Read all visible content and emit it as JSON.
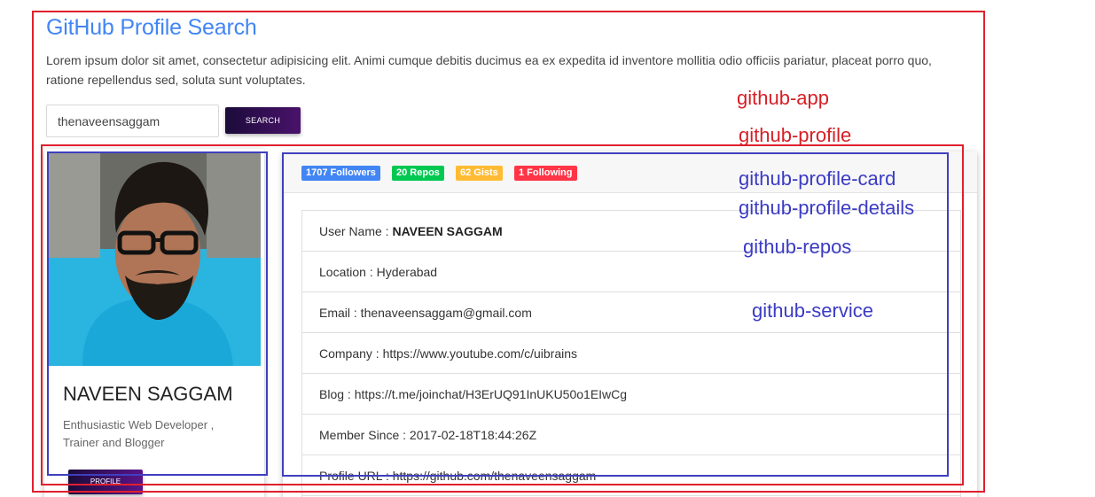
{
  "header": {
    "title": "GitHub Profile Search",
    "description": "Lorem ipsum dolor sit amet, consectetur adipisicing elit. Animi cumque debitis ducimus ea ex expedita id inventore mollitia odio officiis pariatur, placeat porro quo, ratione repellendus sed, soluta sunt voluptates."
  },
  "search": {
    "value": "thenaveensaggam",
    "button_label": "SEARCH"
  },
  "profile_card": {
    "name": "NAVEEN SAGGAM",
    "bio": "Enthusiastic Web Developer , Trainer and Blogger",
    "button_label": "PROFILE"
  },
  "badges": [
    {
      "label": "1707 Followers",
      "color": "#4285f4"
    },
    {
      "label": "20 Repos",
      "color": "#00c851"
    },
    {
      "label": "62 Gists",
      "color": "#ffbb33"
    },
    {
      "label": "1 Following",
      "color": "#ff3547"
    }
  ],
  "details": {
    "username_label": "User Name : ",
    "username": "NAVEEN SAGGAM",
    "location": "Location : Hyderabad",
    "email": "Email : thenaveensaggam@gmail.com",
    "company": "Company : https://www.youtube.com/c/uibrains",
    "blog": "Blog : https://t.me/joinchat/H3ErUQ91InUKU50o1EIwCg",
    "member_since": "Member Since : 2017-02-18T18:44:26Z",
    "profile_url": "Profile URL : https://github.com/thenaveensaggam"
  },
  "annotations": {
    "app": "github-app",
    "profile": "github-profile",
    "profile_card": "github-profile-card",
    "profile_details": "github-profile-details",
    "repos": "github-repos",
    "service": "github-service"
  },
  "colors": {
    "annotation_red": "#e0202e",
    "annotation_blue": "#3f3fbf",
    "title_blue": "#4285f4"
  }
}
